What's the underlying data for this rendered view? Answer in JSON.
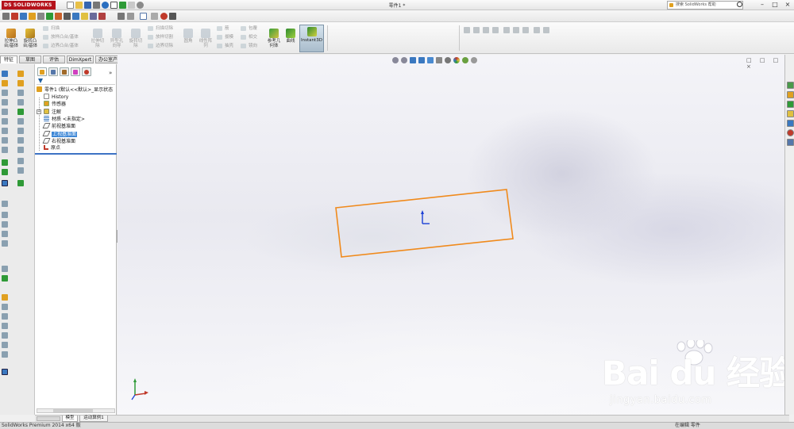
{
  "app": {
    "logo_text": "SOLIDWORKS",
    "document_title": "零件1 *",
    "help_search_placeholder": "搜索 SolidWorks 帮助",
    "window_buttons": [
      "–",
      "□",
      "×"
    ]
  },
  "ribbon": {
    "extrude_boss": "拉伸凸\n台/基体",
    "revolve_boss": "旋转凸\n台/基体",
    "sweep": "扫描",
    "loft": "放样凸台/基体",
    "boundary_boss": "边界凸台/基体",
    "extrude_cut": "拉伸切\n除",
    "hole_wizard": "异型孔\n向导",
    "revolve_cut": "旋转切\n除",
    "sweep_cut": "扫描切除",
    "loft_cut": "放样切割",
    "boundary_cut": "边界切除",
    "fillet": "圆角",
    "linear_pattern": "线性阵\n列",
    "rib": "筋",
    "draft": "拔模",
    "shell": "抽壳",
    "wrap": "包覆",
    "intersect": "相交",
    "mirror": "镜向",
    "reference_geometry": "参考几\n何体",
    "curves": "曲线",
    "instant3d": "Instant3D"
  },
  "tabs": [
    "特征",
    "草图",
    "评估",
    "DimXpert",
    "办公室产品"
  ],
  "feature_tree": {
    "root": "零件1 (默认<<默认>_显示状态",
    "items": [
      {
        "label": "History",
        "icon": "history-icon"
      },
      {
        "label": "传感器",
        "icon": "sensor-icon"
      },
      {
        "label": "注解",
        "icon": "annotation-icon"
      },
      {
        "label": "材质 <未指定>",
        "icon": "material-icon"
      },
      {
        "label": "前视基准面",
        "icon": "plane-icon"
      },
      {
        "label": "上视基准面",
        "icon": "plane-icon"
      },
      {
        "label": "右视基准面",
        "icon": "plane-icon"
      },
      {
        "label": "原点",
        "icon": "origin-icon"
      }
    ],
    "selected_index": 5,
    "expand_label": "»"
  },
  "bottom_tabs": [
    "模型",
    "运动算例1"
  ],
  "status": {
    "left": "SolidWorks Premium 2014 x64 版",
    "right": "在编辑 零件"
  },
  "watermark": {
    "brand": "Bai du 经验",
    "url": "jingyan.baidu.com"
  },
  "colors": {
    "sketch": "#f08a1c",
    "selection": "#3b86d6",
    "logo": "#b5121b",
    "origin": "#1a3fd6"
  }
}
